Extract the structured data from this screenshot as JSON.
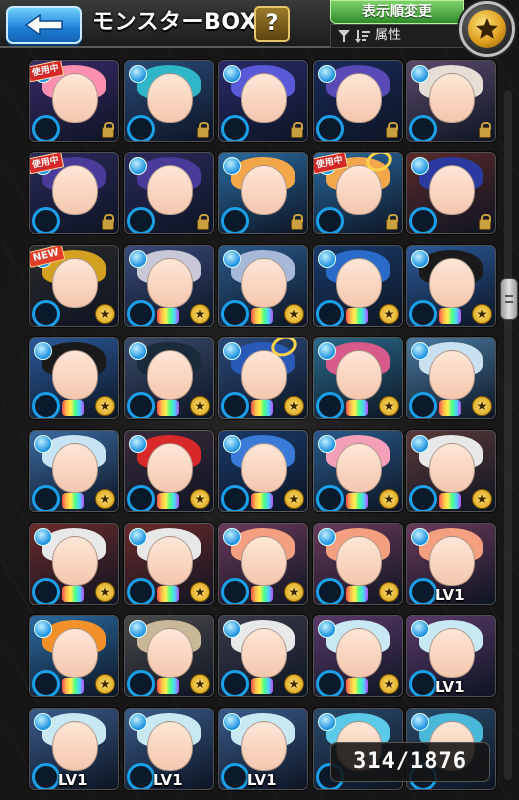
{
  "header": {
    "title": "モンスターBOX",
    "help_label": "?",
    "sort_button_label": "表示順変更",
    "sort_value": "属性"
  },
  "counter": {
    "current": "314",
    "total": "1876",
    "text": "314/1876"
  },
  "colors": {
    "accent_blue": "#1f7fd6",
    "sort_green": "#2f8a2a",
    "element_water": "#1aa0e8",
    "gold": "#e0a020"
  },
  "monsters": [
    {
      "hair": "#ff8fb0",
      "bg": "#3a2a6a",
      "badge": "使用中",
      "lock": true
    },
    {
      "hair": "#2fb6c8",
      "bg": "#2a4a7a",
      "lock": true
    },
    {
      "hair": "#5a5ad8",
      "bg": "#2a2a6a",
      "lock": true
    },
    {
      "hair": "#5a4ab8",
      "bg": "#1a2a5a",
      "lock": true
    },
    {
      "hair": "#e6ddd6",
      "bg": "#5a4a6a",
      "lock": true
    },
    {
      "hair": "#4a3a9a",
      "bg": "#2a2a5a",
      "badge": "使用中",
      "lock": true
    },
    {
      "hair": "#4a3a9a",
      "bg": "#2a2a5a",
      "lock": true
    },
    {
      "hair": "#f4a64a",
      "bg": "#2a6aa0",
      "lock": true
    },
    {
      "hair": "#f4a64a",
      "bg": "#2a6aa0",
      "badge": "使用中",
      "link": true,
      "lock": true
    },
    {
      "hair": "#2a3aa0",
      "bg": "#5a2a2a",
      "lock": true
    },
    {
      "hair": "#d4a020",
      "bg": "#2a2a2a",
      "badge": "NEW",
      "star": true
    },
    {
      "hair": "#c8c8d8",
      "bg": "#3a4a7a",
      "kyoku": true,
      "star": true
    },
    {
      "hair": "#a8b8d8",
      "bg": "#2a5a8a",
      "kyoku": true,
      "star": true
    },
    {
      "hair": "#2a6ac8",
      "bg": "#1a3a6a",
      "kyoku": true,
      "star": true
    },
    {
      "hair": "#1a1a1a",
      "bg": "#2a5a9a",
      "kyoku": true,
      "star": true
    },
    {
      "hair": "#1a1a1a",
      "bg": "#2a5a9a",
      "kyoku": true,
      "star": true
    },
    {
      "hair": "#1a2a3a",
      "bg": "#3a4a6a",
      "kyoku": true,
      "star": true
    },
    {
      "hair": "#2a5ab8",
      "bg": "#2a4a7a",
      "kyoku": true,
      "link": true,
      "star": true
    },
    {
      "hair": "#d85a8a",
      "bg": "#2a6a8a",
      "kyoku": true,
      "star": true
    },
    {
      "hair": "#c8e0f0",
      "bg": "#4a7aa0",
      "kyoku": true,
      "star": true
    },
    {
      "hair": "#c8e4f4",
      "bg": "#3a6aa0",
      "kyoku": true,
      "star": true
    },
    {
      "hair": "#d8282a",
      "bg": "#3a2a3a",
      "kyoku": true,
      "star": true
    },
    {
      "hair": "#3a7ad8",
      "bg": "#1a3a6a",
      "kyoku": true,
      "star": true
    },
    {
      "hair": "#f4a0b8",
      "bg": "#2a5a8a",
      "kyoku": true,
      "star": true
    },
    {
      "hair": "#e8e8e8",
      "bg": "#5a3a3a",
      "kyoku": true,
      "star": true
    },
    {
      "hair": "#e8e8e8",
      "bg": "#6a2a2a",
      "kyoku": true,
      "star": true
    },
    {
      "hair": "#e8e8e8",
      "bg": "#6a2a2a",
      "kyoku": true,
      "star": true
    },
    {
      "hair": "#f4a080",
      "bg": "#6a3a5a",
      "kyoku": true,
      "star": true
    },
    {
      "hair": "#f4a080",
      "bg": "#6a3a5a",
      "kyoku": true,
      "star": true
    },
    {
      "hair": "#f4a080",
      "bg": "#6a3a5a",
      "lv": "LV1"
    },
    {
      "hair": "#f4902a",
      "bg": "#2a6aa0",
      "kyoku": true,
      "star": true
    },
    {
      "hair": "#c8b898",
      "bg": "#4a4a4a",
      "kyoku": true,
      "star": true
    },
    {
      "hair": "#e8e8e8",
      "bg": "#3a3a4a",
      "kyoku": true,
      "star": true
    },
    {
      "hair": "#c8e8f4",
      "bg": "#5a3a6a",
      "kyoku": true,
      "star": true
    },
    {
      "hair": "#c8e8f4",
      "bg": "#5a3a6a",
      "lv": "LV1"
    },
    {
      "hair": "#c8e8f4",
      "bg": "#3a5a8a",
      "lv": "LV1"
    },
    {
      "hair": "#c8e8f4",
      "bg": "#3a5a8a",
      "lv": "LV1"
    },
    {
      "hair": "#c8e8f4",
      "bg": "#3a5a8a",
      "lv": "LV1"
    },
    {
      "hair": "#5acae8",
      "bg": "#2a4a6a"
    },
    {
      "hair": "#4ab8d8",
      "bg": "#2a4a6a"
    }
  ]
}
